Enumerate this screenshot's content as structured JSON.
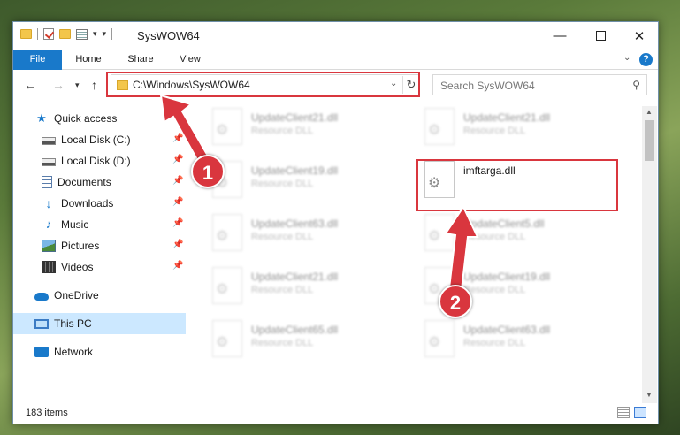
{
  "window": {
    "title": "SysWOW64"
  },
  "ribbon": {
    "tabs": [
      "File",
      "Home",
      "Share",
      "View"
    ],
    "help": "?"
  },
  "navbar": {
    "address": "C:\\Windows\\SysWOW64",
    "search_placeholder": "Search SysWOW64"
  },
  "sidebar": {
    "items": [
      {
        "label": "Quick access",
        "icon": "star-icon",
        "pinned": false
      },
      {
        "label": "Local Disk (C:)",
        "icon": "disk-icon",
        "pinned": true
      },
      {
        "label": "Local Disk (D:)",
        "icon": "disk-icon",
        "pinned": true
      },
      {
        "label": "Documents",
        "icon": "documents-icon",
        "pinned": true
      },
      {
        "label": "Downloads",
        "icon": "download-icon",
        "pinned": true
      },
      {
        "label": "Music",
        "icon": "music-icon",
        "pinned": true
      },
      {
        "label": "Pictures",
        "icon": "pictures-icon",
        "pinned": true
      },
      {
        "label": "Videos",
        "icon": "videos-icon",
        "pinned": true
      },
      {
        "label": "OneDrive",
        "icon": "cloud-icon",
        "pinned": false
      },
      {
        "label": "This PC",
        "icon": "pc-icon",
        "pinned": false,
        "selected": true
      },
      {
        "label": "Network",
        "icon": "network-icon",
        "pinned": false
      }
    ]
  },
  "files": [
    {
      "name": "UpdateClient21.dll",
      "type": "Resource DLL"
    },
    {
      "name": "UpdateClient21.dll",
      "type": "Resource DLL"
    },
    {
      "name": "UpdateClient19.dll",
      "type": "Resource DLL"
    },
    {
      "name": "imftarga.dll",
      "type": ""
    },
    {
      "name": "UpdateClient63.dll",
      "type": "Resource DLL"
    },
    {
      "name": "UpdateClient5.dll",
      "type": "Resource DLL"
    },
    {
      "name": "UpdateClient21.dll",
      "type": "Resource DLL"
    },
    {
      "name": "UpdateClient19.dll",
      "type": "Resource DLL"
    },
    {
      "name": "UpdateClient65.dll",
      "type": "Resource DLL"
    },
    {
      "name": "UpdateClient63.dll",
      "type": "Resource DLL"
    }
  ],
  "status": {
    "item_count": "183 items"
  },
  "annotations": {
    "step1": "1",
    "step2": "2",
    "color": "#d9363e"
  }
}
